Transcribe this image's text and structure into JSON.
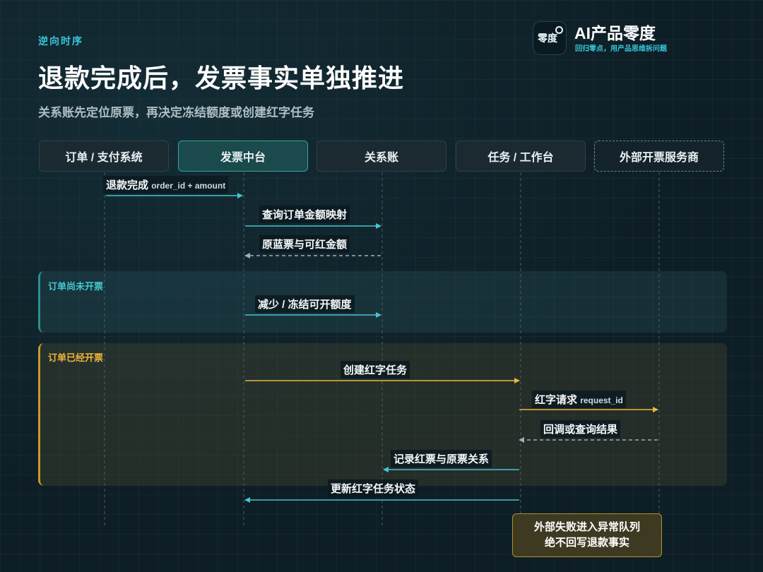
{
  "header": {
    "eyebrow": "逆向时序",
    "title": "退款完成后，发票事实单独推进",
    "subtitle": "关系账先定位原票，再决定冻结额度或创建红字任务"
  },
  "brand": {
    "logo_text": "零度",
    "name": "AI产品零度",
    "tagline": "回归零点，用产品思维拆问题"
  },
  "actors": [
    {
      "label": "订单 / 支付系统"
    },
    {
      "label": "发票中台"
    },
    {
      "label": "关系账"
    },
    {
      "label": "任务 / 工作台"
    },
    {
      "label": "外部开票服务商"
    }
  ],
  "regions": {
    "not_invoiced": "订单尚未开票",
    "invoiced": "订单已经开票"
  },
  "messages": [
    {
      "text": "退款完成",
      "param": "order_id + amount"
    },
    {
      "text": "查询订单金额映射"
    },
    {
      "text": "原蓝票与可红金额"
    },
    {
      "text": "减少 / 冻结可开额度"
    },
    {
      "text": "创建红字任务"
    },
    {
      "text": "红字请求",
      "param": "request_id"
    },
    {
      "text": "回调或查询结果"
    },
    {
      "text": "记录红票与原票关系"
    },
    {
      "text": "更新红字任务状态"
    }
  ],
  "note": {
    "line1": "外部失败进入异常队列",
    "line2": "绝不回写退款事实"
  },
  "colors": {
    "accent_teal": "#38c6d9",
    "accent_amber": "#f0b43a",
    "background": "#0e1e26"
  }
}
